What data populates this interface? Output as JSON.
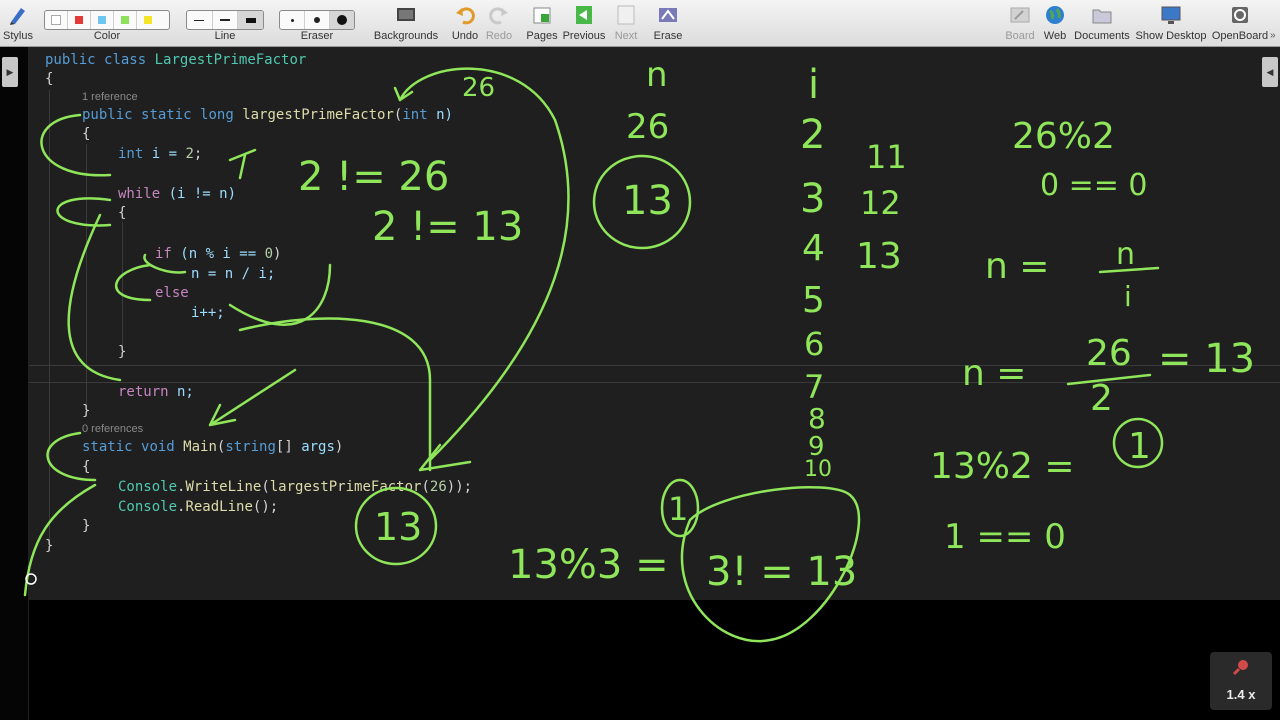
{
  "toolbar": {
    "left": [
      {
        "id": "stylus",
        "label": "Stylus",
        "icon": "stylus-icon"
      },
      {
        "id": "color",
        "label": "Color"
      },
      {
        "id": "line",
        "label": "Line"
      },
      {
        "id": "eraser",
        "label": "Eraser"
      },
      {
        "id": "backgrounds",
        "label": "Backgrounds",
        "icon": "backgrounds-icon"
      },
      {
        "id": "undo",
        "label": "Undo",
        "icon": "undo-icon"
      },
      {
        "id": "redo",
        "label": "Redo",
        "icon": "redo-icon",
        "disabled": true
      },
      {
        "id": "pages",
        "label": "Pages",
        "icon": "pages-icon"
      },
      {
        "id": "previous",
        "label": "Previous",
        "icon": "previous-icon"
      },
      {
        "id": "next",
        "label": "Next",
        "icon": "next-icon",
        "disabled": true
      },
      {
        "id": "erase",
        "label": "Erase",
        "icon": "erase-icon"
      }
    ],
    "right": [
      {
        "id": "board",
        "label": "Board",
        "icon": "board-icon",
        "disabled": true
      },
      {
        "id": "web",
        "label": "Web",
        "icon": "globe-icon"
      },
      {
        "id": "documents",
        "label": "Documents",
        "icon": "folder-icon"
      },
      {
        "id": "show_desktop",
        "label": "Show Desktop",
        "icon": "monitor-icon"
      },
      {
        "id": "openboard",
        "label": "OpenBoard",
        "icon": "gear-icon"
      }
    ],
    "colors": [
      "#ffffff",
      "#e53935",
      "#6ec6f0",
      "#8de05a",
      "#f5e52a"
    ],
    "accent_ink": "#8fe65a"
  },
  "code": {
    "class_line": [
      "public",
      "class",
      "LargestPrimeFactor"
    ],
    "open_brace": "{",
    "ref1": "1 reference",
    "sig": [
      "public",
      "static",
      "long",
      "largestPrimeFactor",
      "(",
      "int",
      " n)"
    ],
    "brace": "{",
    "init": [
      "int",
      " i = ",
      "2",
      ";"
    ],
    "while_line": [
      "while",
      " (i != n)"
    ],
    "if_line": [
      "if",
      " (n % i == ",
      "0",
      ")"
    ],
    "assign": "n = n / i;",
    "else_kw": "else",
    "incr": "i++;",
    "close": "}",
    "return_line": [
      "return",
      " n;"
    ],
    "ref0": "0 references",
    "main_sig": [
      "static",
      "void",
      "Main",
      "(",
      "string",
      "[] ",
      "args",
      ")"
    ],
    "wl": [
      "Console",
      ".",
      "WriteLine",
      "(",
      "largestPrimeFactor",
      "(",
      "26",
      "));"
    ],
    "rl": [
      "Console",
      ".",
      "ReadLine",
      "();"
    ]
  },
  "annotations": {
    "n_label": "n",
    "n_val": "26",
    "n_circled": "13",
    "top_26": "26",
    "ineq1": "2 != 26",
    "ineq2": "2 != 13",
    "i_label": "i",
    "i_vals": [
      "2",
      "3",
      "4",
      "5",
      "6",
      "7",
      "8",
      "9",
      "10"
    ],
    "mid_vals": [
      "11",
      "12",
      "13"
    ],
    "mod1": "26%2",
    "eq_zero": "0 == 0",
    "n_eq": "n =",
    "n_over_i_num": "n",
    "n_over_i_den": "i",
    "n_eq2": "n =",
    "frac_num": "26",
    "frac_den": "2",
    "eq_13": "= 13",
    "mod2": "13%2 =",
    "one_circ": "1",
    "one_eq": "1 == 0",
    "mod3": "13%3 =",
    "circle_13_main": "13",
    "big_circle": "3! = 13"
  },
  "zoom": {
    "label": "1.4 x",
    "icon": "zoom-icon"
  }
}
